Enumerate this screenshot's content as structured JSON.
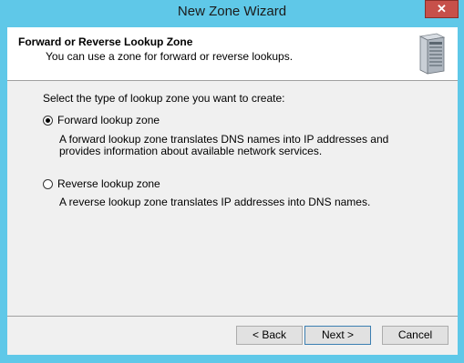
{
  "window": {
    "title": "New Zone Wizard",
    "close_glyph": "✕"
  },
  "header": {
    "title": "Forward or Reverse Lookup Zone",
    "subtitle": "You can use a zone for forward or reverse lookups.",
    "icon": "server-icon"
  },
  "main": {
    "prompt": "Select the type of lookup zone you want to create:",
    "options": [
      {
        "label": "Forward lookup zone",
        "selected": true,
        "description": "A forward lookup zone translates DNS names into IP addresses and provides information about available network services."
      },
      {
        "label": "Reverse lookup zone",
        "selected": false,
        "description": "A reverse lookup zone translates IP addresses into DNS names."
      }
    ]
  },
  "buttons": {
    "back": "< Back",
    "next": "Next >",
    "cancel": "Cancel"
  }
}
